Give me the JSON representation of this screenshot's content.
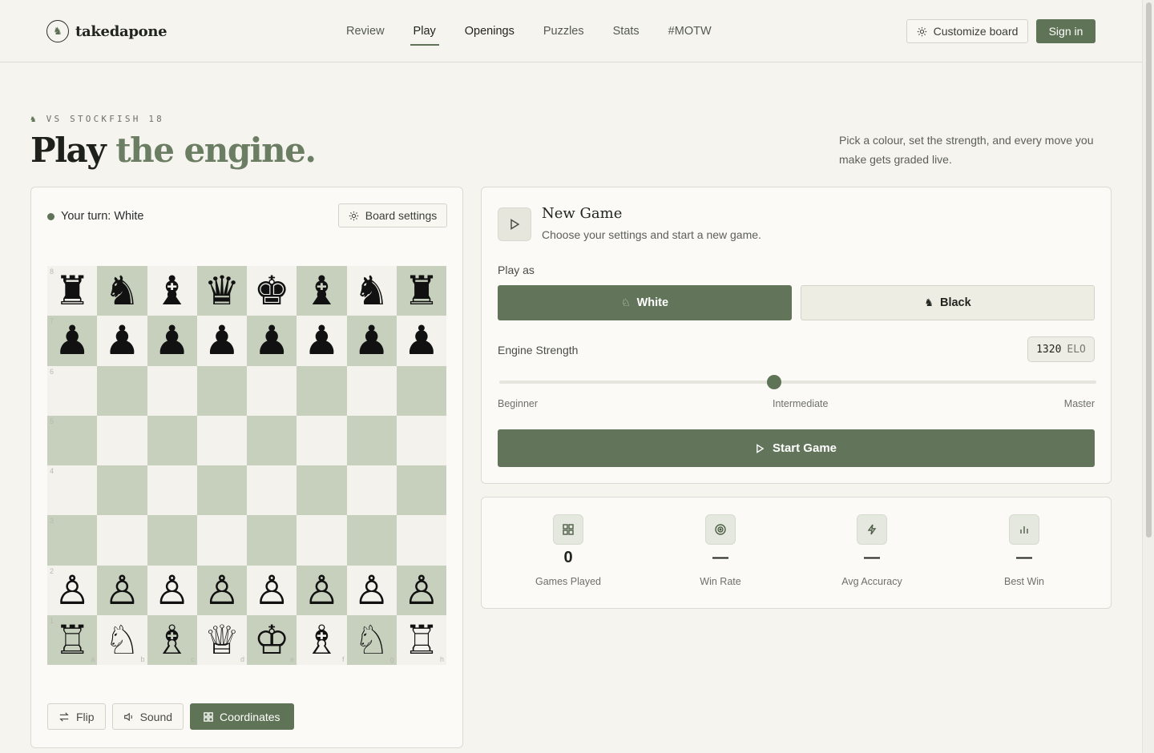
{
  "brand": {
    "name": "takedapone",
    "logo_icon": "knight-icon"
  },
  "nav": [
    {
      "label": "Review",
      "active": false
    },
    {
      "label": "Play",
      "active": true
    },
    {
      "label": "Openings",
      "active": false
    },
    {
      "label": "Puzzles",
      "active": false
    },
    {
      "label": "Stats",
      "active": false
    },
    {
      "label": "#MOTW",
      "active": false
    }
  ],
  "header": {
    "customize_label": "Customize board",
    "signin_label": "Sign in"
  },
  "hero": {
    "eyebrow": "VS STOCKFISH 18",
    "title_main": "Play",
    "title_accent": "the engine.",
    "description": "Pick a colour, set the strength, and every move you make gets graded live."
  },
  "board": {
    "turn_text": "Your turn: White",
    "settings_label": "Board settings",
    "ranks": [
      "8",
      "7",
      "6",
      "5",
      "4",
      "3",
      "2",
      "1"
    ],
    "files": [
      "a",
      "b",
      "c",
      "d",
      "e",
      "f",
      "g",
      "h"
    ],
    "position": [
      [
        "♜",
        "♞",
        "♝",
        "♛",
        "♚",
        "♝",
        "♞",
        "♜"
      ],
      [
        "♟",
        "♟",
        "♟",
        "♟",
        "♟",
        "♟",
        "♟",
        "♟"
      ],
      [
        "",
        "",
        "",
        "",
        "",
        "",
        "",
        ""
      ],
      [
        "",
        "",
        "",
        "",
        "",
        "",
        "",
        ""
      ],
      [
        "",
        "",
        "",
        "",
        "",
        "",
        "",
        ""
      ],
      [
        "",
        "",
        "",
        "",
        "",
        "",
        "",
        ""
      ],
      [
        "♙",
        "♙",
        "♙",
        "♙",
        "♙",
        "♙",
        "♙",
        "♙"
      ],
      [
        "♖",
        "♘",
        "♗",
        "♕",
        "♔",
        "♗",
        "♘",
        "♖"
      ]
    ],
    "controls": {
      "flip": "Flip",
      "sound": "Sound",
      "coordinates": "Coordinates"
    }
  },
  "new_game": {
    "title": "New Game",
    "subtitle": "Choose your settings and start a new game.",
    "play_as_label": "Play as",
    "white_label": "White",
    "black_label": "Black",
    "selected_color": "White",
    "strength_label": "Engine Strength",
    "elo_value": "1320",
    "elo_unit": "ELO",
    "slider_fraction": 0.46,
    "scale": {
      "min": "Beginner",
      "mid": "Intermediate",
      "max": "Master"
    },
    "start_label": "Start Game"
  },
  "stats": [
    {
      "icon": "grid-icon",
      "value": "0",
      "label": "Games Played"
    },
    {
      "icon": "target-icon",
      "value": "—",
      "label": "Win Rate"
    },
    {
      "icon": "bolt-icon",
      "value": "—",
      "label": "Avg Accuracy"
    },
    {
      "icon": "bar-chart-icon",
      "value": "—",
      "label": "Best Win"
    }
  ],
  "colors": {
    "accent": "#5f7356",
    "light_square": "#f3f2ec",
    "dark_square": "#c6d0bd",
    "background": "#f5f4ef"
  }
}
